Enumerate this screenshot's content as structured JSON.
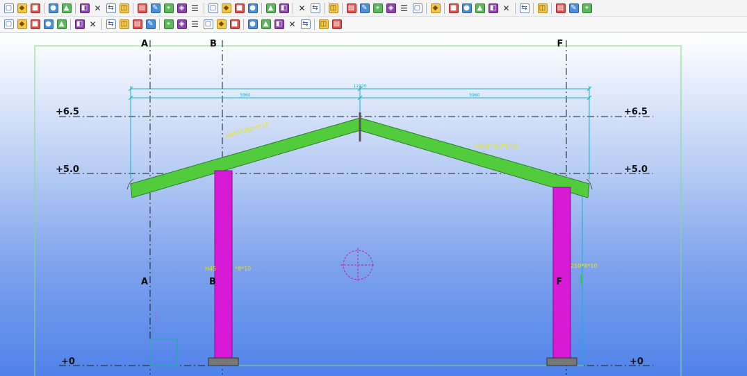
{
  "toolbar_row1": {
    "icons": [
      "new-file-icon",
      "open-folder-icon",
      "save-icon",
      "|",
      "undo-icon",
      "redo-icon",
      "|",
      "copy-icon",
      "paste-icon",
      "print-icon",
      "print-preview-icon",
      "|",
      "window-icon",
      "window-split-icon",
      "window-list-icon",
      "cut-icon",
      "select-all-icon",
      "|",
      "material-icon",
      "layer-icon",
      "member-icon",
      "plate-icon",
      "|",
      "snap-end-icon",
      "snap-mid-icon",
      "|",
      "zoom-in-icon",
      "zoom-out-icon",
      "|",
      "help-icon",
      "|",
      "grid-icon",
      "axis-icon",
      "dimension-icon",
      "angle-icon",
      "arc-icon",
      "flag-icon",
      "|",
      "pin-icon",
      "|",
      "group-icon",
      "export-icon",
      "report-icon",
      "sheet-icon",
      "list-icon",
      "|",
      "render-icon",
      "|",
      "model-icon",
      "|",
      "forward-icon",
      "settings-icon",
      "palette-icon"
    ]
  },
  "toolbar_row2": {
    "icons": [
      "column-icon",
      "beam-icon",
      "brace-icon",
      "purlin-icon",
      "rail-icon",
      "|",
      "bolt-icon",
      "anchor-icon",
      "|",
      "binoculars-icon",
      "section-icon",
      "snap-icon",
      "block-icon",
      "|",
      "weld-icon",
      "tool-icon",
      "paint-icon",
      "stack-icon",
      "connect-icon",
      "split-icon",
      "|",
      "line-icon",
      "slash-icon",
      "diagonal-icon",
      "cross-icon",
      "point-icon",
      "|",
      "offset-icon",
      "circle-icon"
    ]
  },
  "drawing": {
    "axis_labels": {
      "a_top": "A",
      "b_top": "B",
      "f_top": "F",
      "a_mid": "A",
      "b_mid": "B",
      "f_mid": "F"
    },
    "elevations": {
      "top_left": "+6.5",
      "top_right": "+6.5",
      "eave_left": "+5.0",
      "eave_right": "+5.0",
      "base_left": "+0",
      "base_right": "+0"
    },
    "dimensions": {
      "overall": "11920",
      "left_half": "5960",
      "right_half": "5960"
    },
    "members": {
      "left_rafter": "H450*250*8*10",
      "right_rafter": "H450*250*8*10",
      "left_column_part1": "H45",
      "left_column_part2": "*8*10",
      "right_column": "250*8*10"
    },
    "colors": {
      "rafter": "#52cc3c",
      "column": "#d61ad6",
      "grid_line": "#1a1a1a",
      "dimension": "#1ab0c8",
      "boundary": "#7fe07f",
      "label": "#e8e800"
    }
  }
}
